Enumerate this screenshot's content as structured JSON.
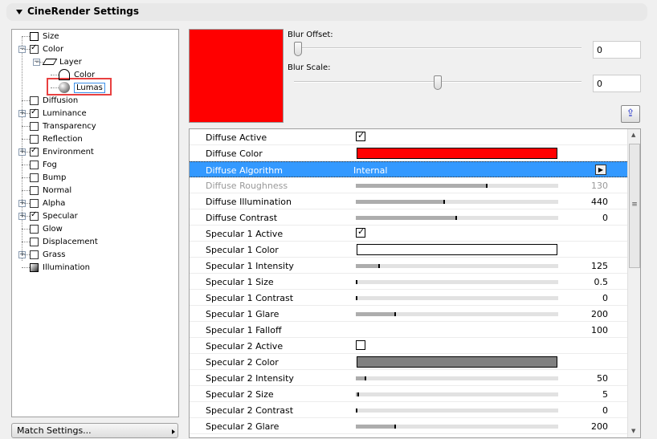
{
  "header": {
    "title": "CineRender Settings"
  },
  "tree": {
    "items": [
      {
        "label": "Size",
        "checked": null
      },
      {
        "label": "Color",
        "checked": true
      },
      {
        "label": "Layer"
      },
      {
        "label": "Color"
      },
      {
        "label": "Lumas"
      },
      {
        "label": "Diffusion",
        "checked": false
      },
      {
        "label": "Luminance",
        "checked": true
      },
      {
        "label": "Transparency",
        "checked": false
      },
      {
        "label": "Reflection",
        "checked": false
      },
      {
        "label": "Environment",
        "checked": true
      },
      {
        "label": "Fog",
        "checked": false
      },
      {
        "label": "Bump",
        "checked": false
      },
      {
        "label": "Normal",
        "checked": false
      },
      {
        "label": "Alpha",
        "checked": false
      },
      {
        "label": "Specular",
        "checked": true
      },
      {
        "label": "Glow",
        "checked": false
      },
      {
        "label": "Displacement",
        "checked": false
      },
      {
        "label": "Grass",
        "checked": false
      },
      {
        "label": "Illumination",
        "checked": null
      }
    ]
  },
  "match_button": "Match Settings...",
  "preview_color": "#ff0000",
  "blur_offset": {
    "label": "Blur Offset:",
    "value": "0",
    "slider": 0.0
  },
  "blur_scale": {
    "label": "Blur Scale:",
    "value": "0",
    "slider": 0.5
  },
  "props": [
    {
      "name": "Diffuse Active",
      "type": "check",
      "checked": true
    },
    {
      "name": "Diffuse Color",
      "type": "color",
      "color": "#ff0000"
    },
    {
      "name": "Diffuse Algorithm",
      "type": "select",
      "value": "Internal"
    },
    {
      "name": "Diffuse Roughness",
      "type": "slider",
      "fill": 0.65,
      "value": "130",
      "disabled": true
    },
    {
      "name": "Diffuse Illumination",
      "type": "slider",
      "fill": 0.44,
      "value": "440"
    },
    {
      "name": "Diffuse Contrast",
      "type": "slider",
      "fill": 0.5,
      "value": "0"
    },
    {
      "name": "Specular 1 Active",
      "type": "check",
      "checked": true
    },
    {
      "name": "Specular 1 Color",
      "type": "color",
      "color": "#ffffff"
    },
    {
      "name": "Specular 1 Intensity",
      "type": "slider",
      "fill": 0.12,
      "value": "125"
    },
    {
      "name": "Specular 1 Size",
      "type": "slider",
      "fill": 0.0,
      "value": "0.5"
    },
    {
      "name": "Specular 1 Contrast",
      "type": "slider",
      "fill": 0.0,
      "value": "0"
    },
    {
      "name": "Specular 1 Glare",
      "type": "slider",
      "fill": 0.2,
      "value": "200"
    },
    {
      "name": "Specular 1 Falloff",
      "type": "value",
      "value": "100"
    },
    {
      "name": "Specular 2 Active",
      "type": "check",
      "checked": false
    },
    {
      "name": "Specular 2 Color",
      "type": "color",
      "color": "#808080"
    },
    {
      "name": "Specular 2 Intensity",
      "type": "slider",
      "fill": 0.05,
      "value": "50"
    },
    {
      "name": "Specular 2 Size",
      "type": "slider",
      "fill": 0.016,
      "value": "5"
    },
    {
      "name": "Specular 2 Contrast",
      "type": "slider",
      "fill": 0.0,
      "value": "0"
    },
    {
      "name": "Specular 2 Glare",
      "type": "slider",
      "fill": 0.2,
      "value": "200"
    }
  ]
}
